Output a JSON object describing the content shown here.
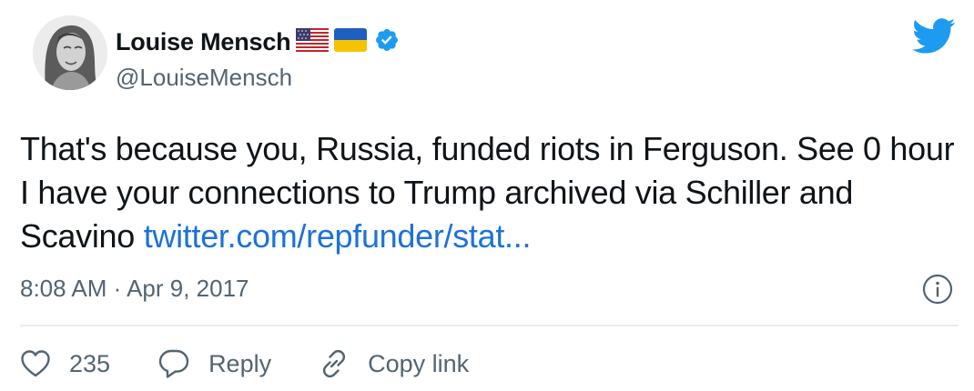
{
  "author": {
    "display_name": "Louise Mensch",
    "handle": "@LouiseMensch",
    "flags": [
      "us-flag-icon",
      "ukraine-flag-icon"
    ],
    "verified": true
  },
  "tweet": {
    "text": "That's because you, Russia, funded riots in Ferguson. See 0 hour I have your connections to Trump archived via Schiller and Scavino ",
    "link_text": "twitter.com/repfunder/stat...",
    "timestamp": "8:08 AM · Apr 9, 2017"
  },
  "actions": {
    "like_count": "235",
    "reply_label": "Reply",
    "copy_link_label": "Copy link"
  },
  "colors": {
    "link": "#1b72d8",
    "twitter_blue": "#1d9bf0",
    "secondary_text": "#536471",
    "divider": "#e6ecf0"
  }
}
